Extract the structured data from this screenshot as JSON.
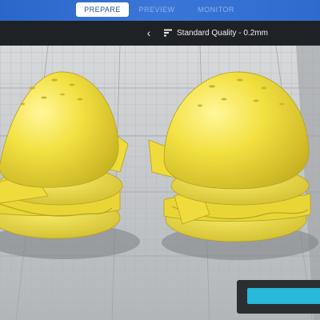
{
  "stages": {
    "prepare": "PREPARE",
    "preview": "PREVIEW",
    "monitor": "MONITOR"
  },
  "settings": {
    "profile_label": "Standard Quality - 0.2mm"
  },
  "icons": {
    "back": "chevron-left-icon",
    "profile": "print-profile-icon"
  },
  "colors": {
    "accent_blue": "#2a67c9",
    "toolbar_dark": "#1e2126",
    "model_yellow": "#f2e040",
    "build_plate": "#bcbfc2",
    "print_button": "#28b8d8"
  },
  "models": [
    {
      "name": "burger-model-left"
    },
    {
      "name": "burger-model-right"
    }
  ]
}
